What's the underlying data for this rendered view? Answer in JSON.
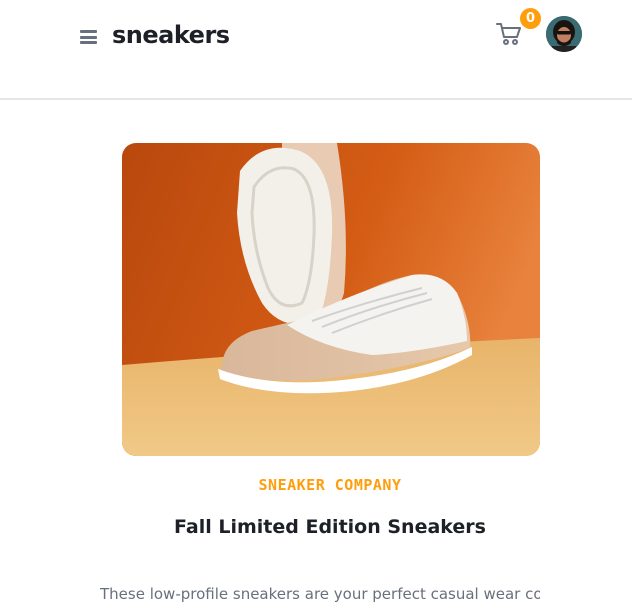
{
  "header": {
    "logo": "sneakers",
    "cart_count": "0"
  },
  "product": {
    "company": "SNEAKER COMPANY",
    "title": "Fall Limited Edition Sneakers",
    "description": "These low-profile sneakers are your perfect casual wear companion."
  },
  "colors": {
    "accent": "#ff9e0c",
    "dark": "#1d2026",
    "muted": "#69707d"
  },
  "icons": {
    "menu": "menu-icon",
    "cart": "cart-icon",
    "avatar": "avatar"
  }
}
